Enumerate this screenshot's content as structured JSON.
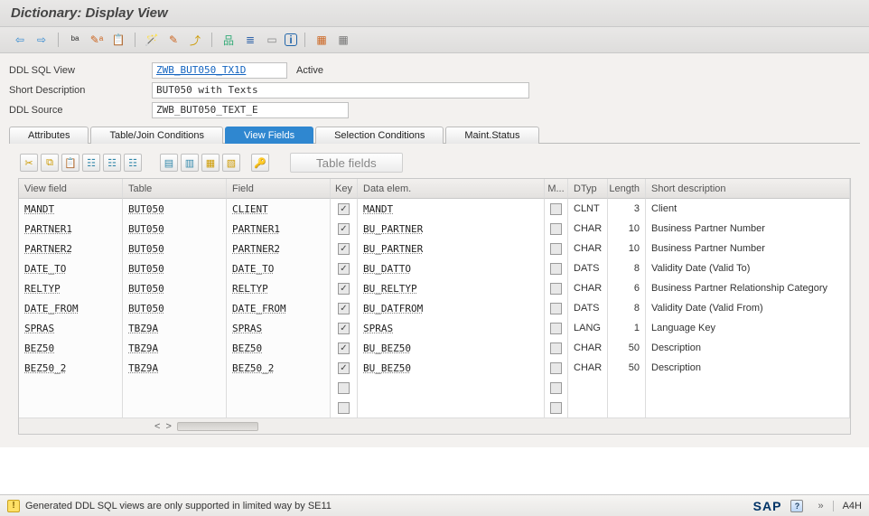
{
  "title": "Dictionary: Display View",
  "header_fields": {
    "ddl_sql_view": {
      "label": "DDL SQL View",
      "value": "ZWB_BUT050_TX1D",
      "status": "Active"
    },
    "short_desc": {
      "label": "Short Description",
      "value": "BUT050 with Texts"
    },
    "ddl_source": {
      "label": "DDL Source",
      "value": "ZWB_BUT050_TEXT_E"
    }
  },
  "tabs": [
    "Attributes",
    "Table/Join Conditions",
    "View Fields",
    "Selection Conditions",
    "Maint.Status"
  ],
  "active_tab": 2,
  "table_fields_btn": "Table fields",
  "columns": {
    "view_field": "View field",
    "table": "Table",
    "field": "Field",
    "key": "Key",
    "data_elem": "Data elem.",
    "m": "M...",
    "dtyp": "DTyp",
    "length": "Length",
    "short_desc": "Short description"
  },
  "rows": [
    {
      "vf": "MANDT",
      "tb": "BUT050",
      "fd": "CLIENT",
      "key": true,
      "de": "MANDT",
      "m": false,
      "dt": "CLNT",
      "len": "3",
      "sd": "Client"
    },
    {
      "vf": "PARTNER1",
      "tb": "BUT050",
      "fd": "PARTNER1",
      "key": true,
      "de": "BU_PARTNER",
      "m": false,
      "dt": "CHAR",
      "len": "10",
      "sd": "Business Partner Number"
    },
    {
      "vf": "PARTNER2",
      "tb": "BUT050",
      "fd": "PARTNER2",
      "key": true,
      "de": "BU_PARTNER",
      "m": false,
      "dt": "CHAR",
      "len": "10",
      "sd": "Business Partner Number"
    },
    {
      "vf": "DATE_TO",
      "tb": "BUT050",
      "fd": "DATE_TO",
      "key": true,
      "de": "BU_DATTO",
      "m": false,
      "dt": "DATS",
      "len": "8",
      "sd": "Validity Date (Valid To)"
    },
    {
      "vf": "RELTYP",
      "tb": "BUT050",
      "fd": "RELTYP",
      "key": true,
      "de": "BU_RELTYP",
      "m": false,
      "dt": "CHAR",
      "len": "6",
      "sd": "Business Partner Relationship Category"
    },
    {
      "vf": "DATE_FROM",
      "tb": "BUT050",
      "fd": "DATE_FROM",
      "key": true,
      "de": "BU_DATFROM",
      "m": false,
      "dt": "DATS",
      "len": "8",
      "sd": "Validity Date (Valid From)"
    },
    {
      "vf": "SPRAS",
      "tb": "TBZ9A",
      "fd": "SPRAS",
      "key": true,
      "de": "SPRAS",
      "m": false,
      "dt": "LANG",
      "len": "1",
      "sd": "Language Key"
    },
    {
      "vf": "BEZ50",
      "tb": "TBZ9A",
      "fd": "BEZ50",
      "key": true,
      "de": "BU_BEZ50",
      "m": false,
      "dt": "CHAR",
      "len": "50",
      "sd": "Description"
    },
    {
      "vf": "BEZ50_2",
      "tb": "TBZ9A",
      "fd": "BEZ50_2",
      "key": true,
      "de": "BU_BEZ50",
      "m": false,
      "dt": "CHAR",
      "len": "50",
      "sd": "Description"
    }
  ],
  "status_message": "Generated DDL SQL views are only supported in limited way by SE11",
  "system_id": "A4H",
  "brand": "SAP"
}
